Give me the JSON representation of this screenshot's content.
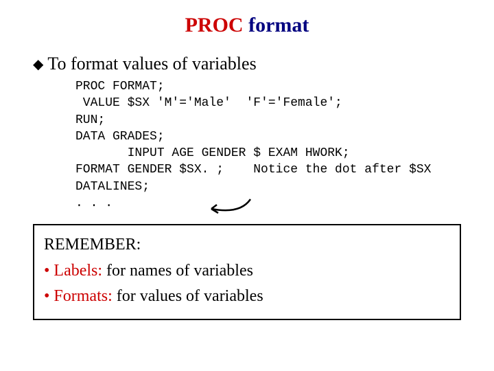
{
  "title": {
    "proc": "PROC",
    "fmt": " format"
  },
  "bullet": "To format values of variables",
  "code": {
    "l1": "PROC FORMAT;",
    "l2": " VALUE $SX 'M'='Male'  'F'='Female';",
    "l3": "RUN;",
    "l4": "DATA GRADES;",
    "l5": "       INPUT AGE GENDER $ EXAM HWORK;",
    "l6": "FORMAT GENDER $SX. ;    Notice the dot after $SX",
    "l7": "DATALINES;",
    "l8": ". . ."
  },
  "remember": {
    "header": "REMEMBER:",
    "labels_prefix": "• Labels:",
    "labels_rest": "  for names of variables",
    "formats_prefix": "• Formats:",
    "formats_rest": "  for values of variables"
  }
}
